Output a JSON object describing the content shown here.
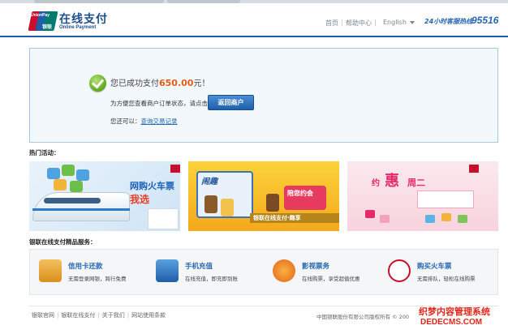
{
  "header": {
    "logo_badge_en": "UnionPay",
    "logo_badge_cn": "银联",
    "logo_title": "在线支付",
    "logo_subtitle": "Online Payment",
    "nav_home": "首页",
    "nav_help": "帮助中心",
    "nav_language": "English",
    "hotline_label": "24小时客服热线",
    "hotline_number": "95516",
    "separator": "|"
  },
  "success": {
    "message_prefix": "您已成功支付",
    "amount": "650.00",
    "message_suffix": "元！",
    "hint": "为方便您查看商户订单状态，请点击",
    "return_button": "返回商户",
    "alt_prefix": "您还可以：",
    "alt_link": "查询交易记录"
  },
  "promotions": {
    "title": "热门活动：",
    "banner1": {
      "brand": "在线支付",
      "line1": "网购火车票",
      "line2": "我选",
      "bank": "中国银联"
    },
    "banner2": {
      "brand": "在线支付",
      "box_label": "闹趣",
      "gift": "陪您约会",
      "strip": "银联在线支付·趣享"
    },
    "banner3": {
      "brand": "在线支付",
      "pre": "约",
      "hui": "惠",
      "post": "周二"
    }
  },
  "services": {
    "title": "银联在线支付精品服务：",
    "items": [
      {
        "icon": "credit-card-icon",
        "title": "信用卡还款",
        "desc": "无需登录网银，跨行免费",
        "color": "#e8a23a"
      },
      {
        "icon": "mobile-phone-icon",
        "title": "手机充值",
        "desc": "在线充值，即充即到账",
        "color": "#2d7cc4"
      },
      {
        "icon": "film-reel-icon",
        "title": "影视票务",
        "desc": "在线购票，享受超值优惠",
        "color": "#f07d1d"
      },
      {
        "icon": "railway-icon",
        "title": "购买火车票",
        "desc": "无需排队，轻松在线购票",
        "color": "#c8102e"
      }
    ]
  },
  "footer": {
    "links": [
      "银联官网",
      "银联在线支付",
      "关于我们",
      "网站使用条款"
    ],
    "copyright": "中国银联股份有限公司版权所有 © 200",
    "watermark_cn": "织梦内容管理系统",
    "watermark_en": "DEDECMS.COM"
  },
  "colors": {
    "brand_blue": "#1f4e8f",
    "accent_orange": "#e25d12",
    "link_blue": "#2866b0",
    "unionpay_red": "#c8102e",
    "unionpay_blue": "#1f5da8",
    "unionpay_green": "#007b6e"
  }
}
